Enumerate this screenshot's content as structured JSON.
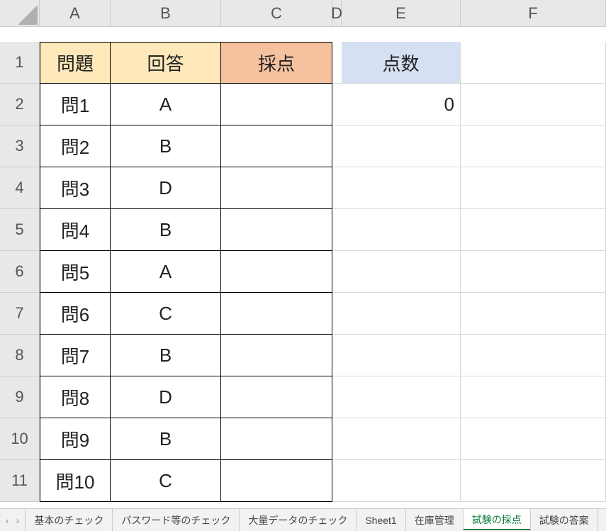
{
  "columns": [
    "A",
    "B",
    "C",
    "D",
    "E",
    "F"
  ],
  "rows": [
    "1",
    "2",
    "3",
    "4",
    "5",
    "6",
    "7",
    "8",
    "9",
    "10",
    "11"
  ],
  "header": {
    "A": "問題",
    "B": "回答",
    "C": "採点",
    "E": "点数"
  },
  "data": [
    {
      "q": "問1",
      "a": "A"
    },
    {
      "q": "問2",
      "a": "B"
    },
    {
      "q": "問3",
      "a": "D"
    },
    {
      "q": "問4",
      "a": "B"
    },
    {
      "q": "問5",
      "a": "A"
    },
    {
      "q": "問6",
      "a": "C"
    },
    {
      "q": "問7",
      "a": "B"
    },
    {
      "q": "問8",
      "a": "D"
    },
    {
      "q": "問9",
      "a": "B"
    },
    {
      "q": "問10",
      "a": "C"
    }
  ],
  "score": "0",
  "tabs": {
    "items": [
      "基本のチェック",
      "パスワード等のチェック",
      "大量データのチェック",
      "Sheet1",
      "在庫管理",
      "試験の採点",
      "試験の答案"
    ],
    "active": "試験の採点"
  }
}
